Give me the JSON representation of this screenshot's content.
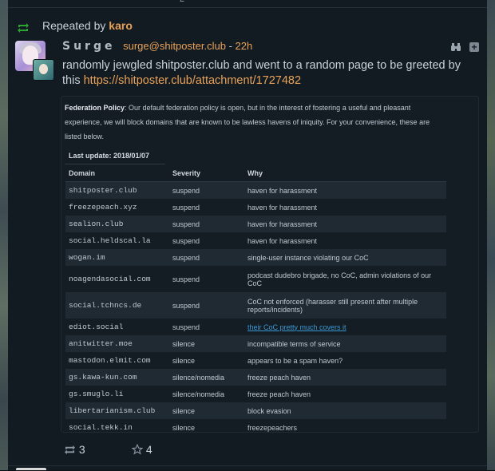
{
  "top": {
    "glyph": "2"
  },
  "repeat": {
    "prefix": "Repeated by",
    "user": "karo"
  },
  "post": {
    "author_name": "Surge",
    "handle": "surge@shitposter.club",
    "separator": "-",
    "time": "22h",
    "text": "randomly jewgled shitposter.club and went to a random page to be greeted by this",
    "link": "https://shitposter.club/attachment/1727482"
  },
  "attachment": {
    "policy_label": "Federation Policy",
    "policy_text": ": Our default federation policy is open, but in the interest of fostering a useful and pleasant experience, we will block domains that are known to be lawless havens of iniquity. For your convenience, these are listed below.",
    "last_update": "Last update: 2018/01/07",
    "columns": [
      "Domain",
      "Severity",
      "Why"
    ],
    "rows": [
      {
        "domain": "shitposter.club",
        "severity": "suspend",
        "why": "haven for harassment"
      },
      {
        "domain": "freezepeach.xyz",
        "severity": "suspend",
        "why": "haven for harassment"
      },
      {
        "domain": "sealion.club",
        "severity": "suspend",
        "why": "haven for harassment"
      },
      {
        "domain": "social.heldscal.la",
        "severity": "suspend",
        "why": "haven for harassment"
      },
      {
        "domain": "wogan.im",
        "severity": "suspend",
        "why": "single-user instance violating our CoC"
      },
      {
        "domain": "noagendasocial.com",
        "severity": "suspend",
        "why": "podcast dudebro brigade, no CoC, admin violations of our CoC"
      },
      {
        "domain": "social.tchncs.de",
        "severity": "suspend",
        "why": "CoC not enforced (harasser still present after multiple reports/incidents)"
      },
      {
        "domain": "ediot.social",
        "severity": "suspend",
        "why": "their CoC pretty much covers it",
        "link": true
      },
      {
        "domain": "anitwitter.moe",
        "severity": "silence",
        "why": "incompatible terms of service"
      },
      {
        "domain": "mastodon.elmit.com",
        "severity": "silence",
        "why": "appears to be a spam haven?"
      },
      {
        "domain": "gs.kawa-kun.com",
        "severity": "silence/nomedia",
        "why": "freeze peach haven"
      },
      {
        "domain": "gs.smuglo.li",
        "severity": "silence/nomedia",
        "why": "freeze peach haven"
      },
      {
        "domain": "libertarianism.club",
        "severity": "silence",
        "why": "block evasion"
      },
      {
        "domain": "social.tekk.in",
        "severity": "silence",
        "why": "freezepeachers"
      }
    ]
  },
  "actions": {
    "repeat_count": "3",
    "favorite_count": "4"
  },
  "icons": {
    "repeat": "repeat-icon",
    "binoculars": "binoculars-icon",
    "expand": "plus-icon",
    "favorite": "star-icon"
  },
  "colors": {
    "accent": "#e8a258",
    "repeat_green": "#2aa52f",
    "link_blue": "#3c9ad6",
    "background": "#121a22"
  }
}
